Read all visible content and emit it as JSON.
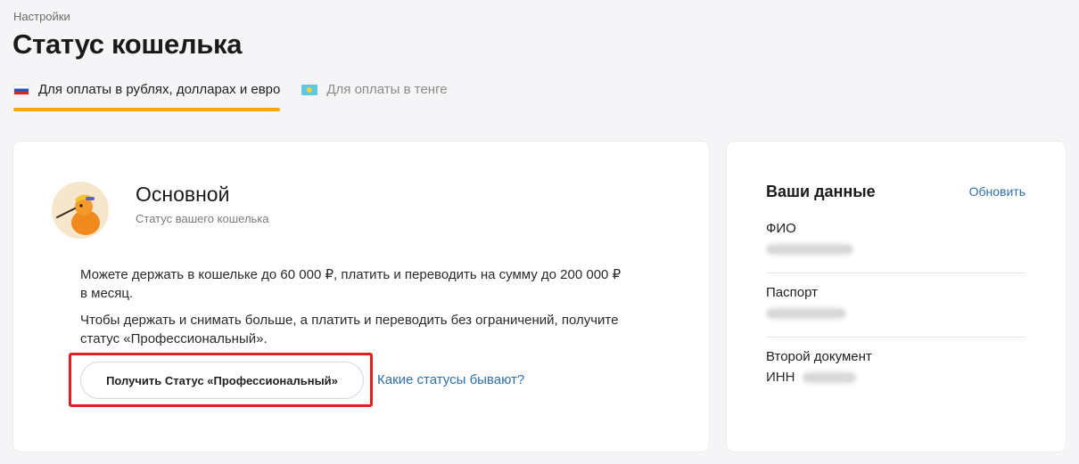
{
  "breadcrumb": "Настройки",
  "page_title": "Статус кошелька",
  "tabs": [
    {
      "label": "Для оплаты в рублях, долларах и евро",
      "flag": "flag-ru-icon",
      "active": true
    },
    {
      "label": "Для оплаты в тенге",
      "flag": "flag-kz-icon",
      "active": false
    }
  ],
  "status_card": {
    "status_name": "Основной",
    "status_subtitle": "Статус вашего кошелька",
    "description_1": "Можете держать в кошельке до 60 000 ₽, платить и переводить на сумму до 200 000 ₽ в месяц.",
    "description_2": "Чтобы держать и снимать больше, а платить и переводить без ограничений, получите статус «Профессиональный».",
    "upgrade_button": "Получить Статус «Профессиональный»",
    "statuses_link": "Какие статусы бывают?"
  },
  "your_data": {
    "title": "Ваши данные",
    "refresh_link": "Обновить",
    "fields": [
      {
        "label": "ФИО"
      },
      {
        "label": "Паспорт"
      },
      {
        "label": "Второй документ",
        "value_prefix": "ИНН"
      }
    ]
  },
  "colors": {
    "accent_tab": "#f2a900",
    "link": "#2f6fa8",
    "highlight": "#e02020",
    "background": "#f5f5f7"
  }
}
